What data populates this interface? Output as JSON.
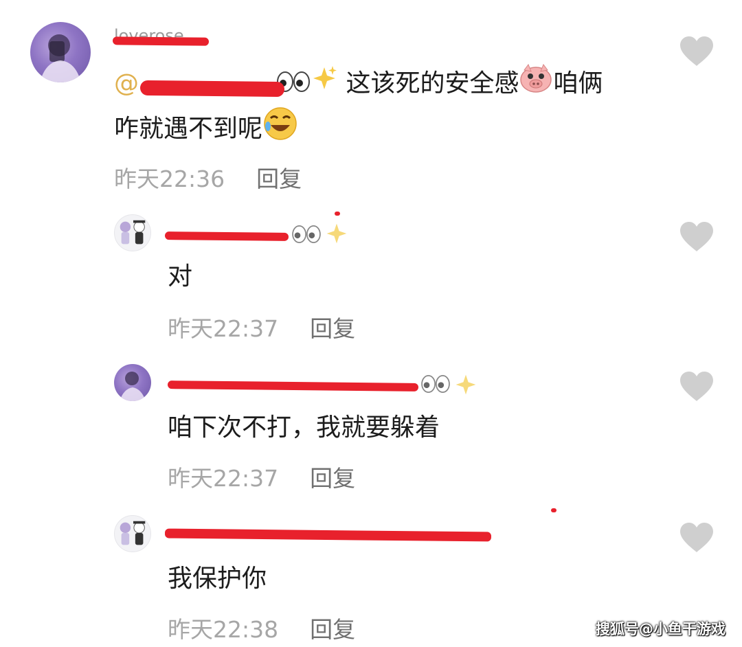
{
  "comments": [
    {
      "username": "loverose",
      "mention": "@",
      "text_part1": "这该死的安全感",
      "text_part2": "咱俩",
      "text_line2": "咋就遇不到呢",
      "time": "昨天22:36",
      "reply_label": "回复",
      "icons": [
        "eyes-icon",
        "sparkles-icon",
        "pig-face-icon",
        "rolling-laughing-icon",
        "heart-icon"
      ]
    },
    {
      "text": "对",
      "time": "昨天22:37",
      "reply_label": "回复"
    },
    {
      "text": "咱下次不打，我就要躲着",
      "time": "昨天22:37",
      "reply_label": "回复"
    },
    {
      "text": "我保护你",
      "time": "昨天22:38",
      "reply_label": "回复"
    }
  ],
  "watermark": "搜狐号@小鱼干游戏",
  "colors": {
    "redaction": "#e8212c",
    "mention": "#e0b14f",
    "heart": "#cfcfcf",
    "timestamp": "#a6a6a6"
  }
}
